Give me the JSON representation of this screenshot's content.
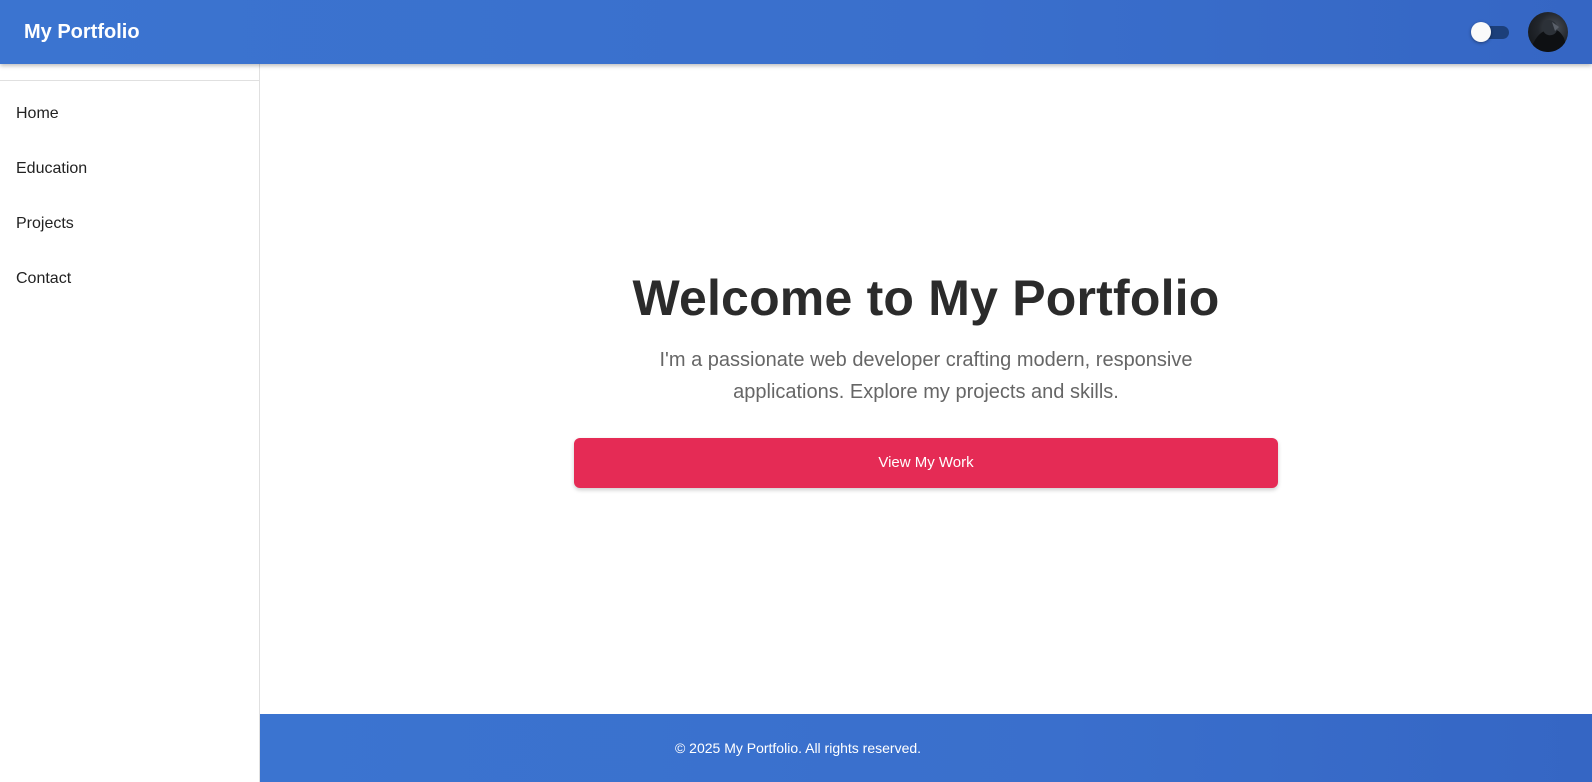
{
  "appbar": {
    "title": "My Portfolio",
    "theme_toggle_icon": "toggle-switch-icon",
    "avatar_icon": "user-avatar"
  },
  "sidebar": {
    "items": [
      {
        "label": "Home"
      },
      {
        "label": "Education"
      },
      {
        "label": "Projects"
      },
      {
        "label": "Contact"
      }
    ]
  },
  "hero": {
    "title": "Welcome to My Portfolio",
    "subtitle": "I'm a passionate web developer crafting modern, responsive applications. Explore my projects and skills.",
    "cta_label": "View My Work"
  },
  "footer": {
    "text": "© 2025 My Portfolio. All rights reserved."
  },
  "colors": {
    "primary": "#3a6fcc",
    "accent": "#e52b55",
    "text": "#2b2b2b",
    "muted_text": "#666666"
  }
}
